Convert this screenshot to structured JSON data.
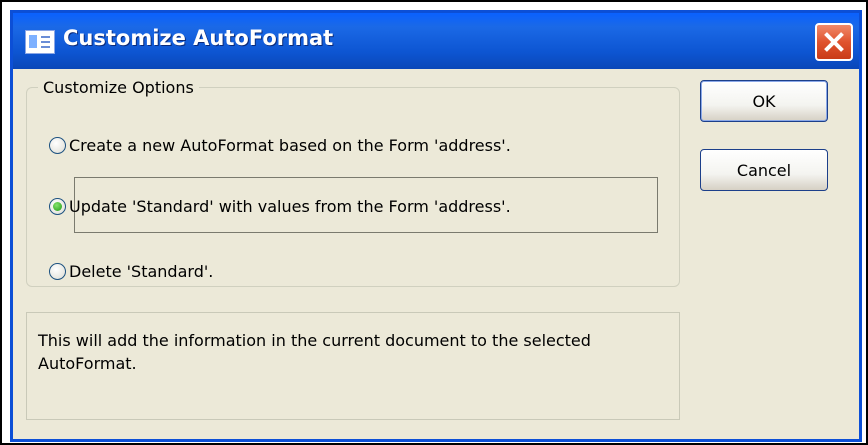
{
  "dialog": {
    "title": "Customize AutoFormat",
    "close_icon": "close-icon"
  },
  "options": {
    "legend": "Customize Options",
    "items": [
      {
        "label": "Create a new AutoFormat based on the Form 'address'.",
        "checked": false
      },
      {
        "label": "Update 'Standard' with values from the Form 'address'.",
        "checked": true
      },
      {
        "label": "Delete 'Standard'.",
        "checked": false
      }
    ]
  },
  "description": "This will add the information in the current document to the selected AutoFormat.",
  "buttons": {
    "ok_label": "OK",
    "cancel_label": "Cancel"
  },
  "colors": {
    "titlebar": "#0a61ff",
    "window_bg": "#ece9d8",
    "close": "#e0532e",
    "radio_selected": "#1f9a12"
  }
}
